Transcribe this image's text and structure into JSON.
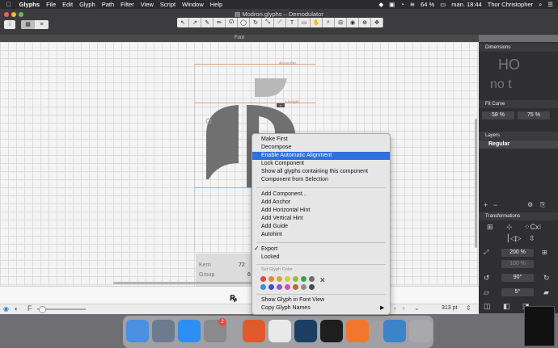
{
  "menubar": {
    "app": "Glyphs",
    "items": [
      "File",
      "Edit",
      "Glyph",
      "Path",
      "Filter",
      "View",
      "Script",
      "Window",
      "Help"
    ],
    "battery": "64 %",
    "clock": "man. 18:44",
    "user": "Thor Christopher"
  },
  "window": {
    "title": "Modron.glyphs – Demodulator",
    "tab": "Font"
  },
  "canvas": {
    "metric_ascender": "Ascender",
    "metric_xheight": "x-height",
    "kern_label": "Kern",
    "kern_value": "72",
    "group_label": "Group",
    "group_value": "6",
    "preview_glyph": "ꝶ"
  },
  "status": {
    "point_size": "313 pt"
  },
  "panel": {
    "dimensions": "Dimensions",
    "dim_preview_top": "HO",
    "dim_preview_bottom": "no t",
    "fit_curve": "Fit Curve",
    "fit_a": "58 %",
    "fit_b": "75 %",
    "layers": "Layers",
    "layer_regular": "Regular",
    "transformations": "Transformations",
    "scale": "200 %",
    "scale2": "100 %",
    "rotate": "90°",
    "slant": "5°"
  },
  "context_menu": {
    "group1": [
      "Make First",
      "Decompose",
      "Enable Automatic Alignment",
      "Lock Component",
      "Show all glyphs containing this component",
      "Component from Selection"
    ],
    "group2": [
      "Add Component...",
      "Add Anchor",
      "Add Horizontal Hint",
      "Add Vertical Hint",
      "Add Guide",
      "Autohint"
    ],
    "export": "Export",
    "locked": "Locked",
    "color_header": "Set Glyph Color",
    "group4": [
      "Show Glyph in Font View",
      "Copy Glyph Names"
    ],
    "highlight_color": "#2f6fe0",
    "colors": [
      "#e0483e",
      "#e8872f",
      "#d4a63a",
      "#d8c83a",
      "#8ac23e",
      "#3aa047",
      "#6d6d6d",
      "#3d8de0",
      "#3050d8",
      "#8f52d8",
      "#d24fb0",
      "#b96a3c",
      "#8d8d8d",
      "#4a4a4a"
    ]
  },
  "dock": {
    "badge": "2"
  }
}
